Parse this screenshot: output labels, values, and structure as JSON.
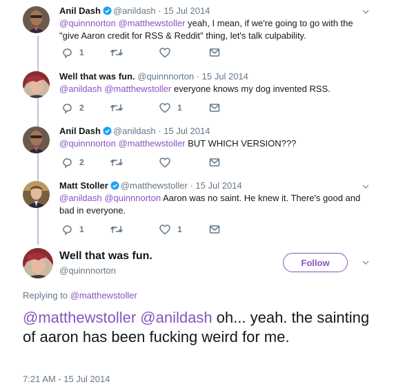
{
  "thread": [
    {
      "name": "Anil Dash",
      "verified": true,
      "handle": "@anildash",
      "date": "15 Jul 2014",
      "mentions": "@quinnnorton @matthewstoller",
      "body": " yeah, I mean, if we're going to go with the \"give Aaron credit for RSS & Reddit\" thing, let's talk culpability.",
      "reply_count": "1",
      "retweet_count": "",
      "like_count": "",
      "avatar": "avatar-anil"
    },
    {
      "name": "Well that was fun.",
      "verified": false,
      "handle": "@quinnnorton",
      "date": "15 Jul 2014",
      "mentions": "@anildash @matthewstoller",
      "body": " everyone knows my dog invented RSS.",
      "reply_count": "2",
      "retweet_count": "",
      "like_count": "1",
      "avatar": "avatar-quinn"
    },
    {
      "name": "Anil Dash",
      "verified": true,
      "handle": "@anildash",
      "date": "15 Jul 2014",
      "mentions": "@quinnnorton @matthewstoller",
      "body": " BUT WHICH VERSION???",
      "reply_count": "2",
      "retweet_count": "",
      "like_count": "",
      "avatar": "avatar-anil"
    },
    {
      "name": "Matt Stoller",
      "verified": true,
      "handle": "@matthewstoller",
      "date": "15 Jul 2014",
      "mentions": "@anildash @quinnnorton",
      "body": " Aaron was no saint. He knew it. There's good and bad in everyone.",
      "reply_count": "1",
      "retweet_count": "",
      "like_count": "1",
      "avatar": "avatar-matt"
    }
  ],
  "main": {
    "name": "Well that was fun.",
    "handle": "@quinnnorton",
    "follow_label": "Follow",
    "replying_prefix": "Replying to ",
    "replying_handle": "@matthewstoller",
    "mentions": "@matthewstoller @anildash",
    "body": " oh... yeah. the sainting of aaron has been fucking weird for me.",
    "timestamp": "7:21 AM - 15 Jul 2014"
  },
  "colors": {
    "accent": "#8852c2",
    "verified": "#1da1f2",
    "muted": "#657786",
    "thread_line": "#c6bde3"
  },
  "separator": "·"
}
